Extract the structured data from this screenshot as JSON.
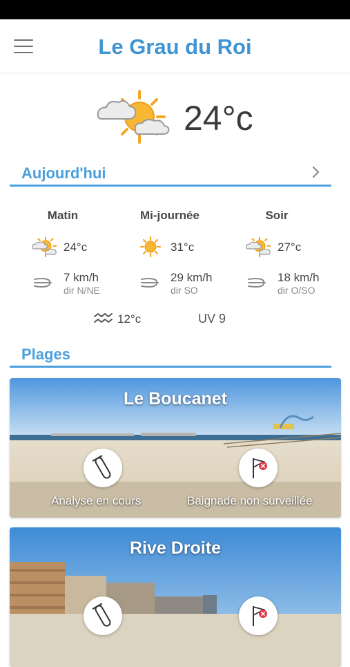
{
  "header": {
    "title": "Le Grau du Roi",
    "menu_icon": "menu-icon"
  },
  "current": {
    "icon": "sun-behind-clouds-icon",
    "temperature": "24°c"
  },
  "today": {
    "title": "Aujourd'hui",
    "periods": [
      {
        "name": "Matin",
        "icon": "sun-behind-cloud-icon",
        "temperature": "24°c",
        "wind_speed": "7 km/h",
        "wind_direction": "dir N/NE"
      },
      {
        "name": "Mi-journée",
        "icon": "sun-icon",
        "temperature": "31°c",
        "wind_speed": "29 km/h",
        "wind_direction": "dir SO"
      },
      {
        "name": "Soir",
        "icon": "sun-behind-cloud-icon",
        "temperature": "27°c",
        "wind_speed": "18 km/h",
        "wind_direction": "dir O/SO"
      }
    ],
    "sea_temperature": "12°c",
    "uv": "UV 9"
  },
  "beaches": {
    "title": "Plages",
    "items": [
      {
        "name": "Le Boucanet",
        "analysis_label": "Analyse en cours",
        "supervision_label": "Baignade non surveillée"
      },
      {
        "name": "Rive Droite",
        "analysis_label": "",
        "supervision_label": ""
      }
    ]
  },
  "colors": {
    "accent": "#3f95d3",
    "section_rule": "#4b9fdc",
    "flag_red": "#e23b4a"
  }
}
